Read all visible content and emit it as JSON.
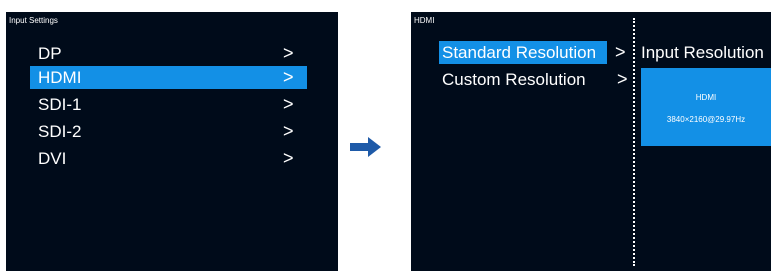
{
  "left_screen": {
    "title": "Input Settings",
    "items": [
      {
        "label": "DP",
        "arrow": ">",
        "selected": false
      },
      {
        "label": "HDMI",
        "arrow": ">",
        "selected": true
      },
      {
        "label": "SDI-1",
        "arrow": ">",
        "selected": false
      },
      {
        "label": "SDI-2",
        "arrow": ">",
        "selected": false
      },
      {
        "label": "DVI",
        "arrow": ">",
        "selected": false
      }
    ]
  },
  "right_screen": {
    "title": "HDMI",
    "items": [
      {
        "label": "Standard Resolution",
        "arrow": ">",
        "selected": true
      },
      {
        "label": "Custom Resolution",
        "arrow": ">",
        "selected": false
      }
    ],
    "input_resolution": {
      "title": "Input Resolution",
      "source": "HDMI",
      "value": "3840×2160@29.97Hz"
    }
  },
  "icons": {
    "flow_arrow": "right-arrow-icon"
  },
  "colors": {
    "screen_background": "#000b1a",
    "highlight": "#1390e6",
    "text": "#ffffff",
    "flow_arrow": "#1e5aa8"
  }
}
